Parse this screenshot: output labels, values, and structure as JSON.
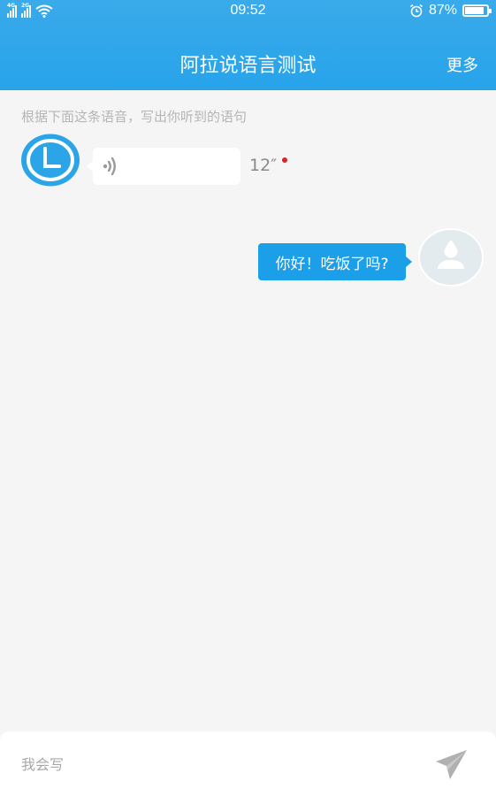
{
  "status_bar": {
    "time": "09:52",
    "battery_percent": "87%",
    "battery_level": 0.87,
    "network_1": "4G",
    "network_2": "2G",
    "icons": [
      "signal-icon",
      "signal-icon",
      "wifi-icon",
      "alarm-icon",
      "battery-icon"
    ]
  },
  "header": {
    "title": "阿拉说语言测试",
    "more_label": "更多"
  },
  "instruction": "根据下面这条语音，写出你听到的语句",
  "voice_message": {
    "duration": "12″",
    "unread": true,
    "icon": "voice-wave-icon"
  },
  "user_message": {
    "text": "你好！吃饭了吗?"
  },
  "input_bar": {
    "placeholder": "我会写",
    "send_icon": "send-icon"
  },
  "colors": {
    "header": "#2aa5ea",
    "bubble": "#1a9fe8",
    "background": "#f5f5f5",
    "unread_dot": "#e02424"
  }
}
